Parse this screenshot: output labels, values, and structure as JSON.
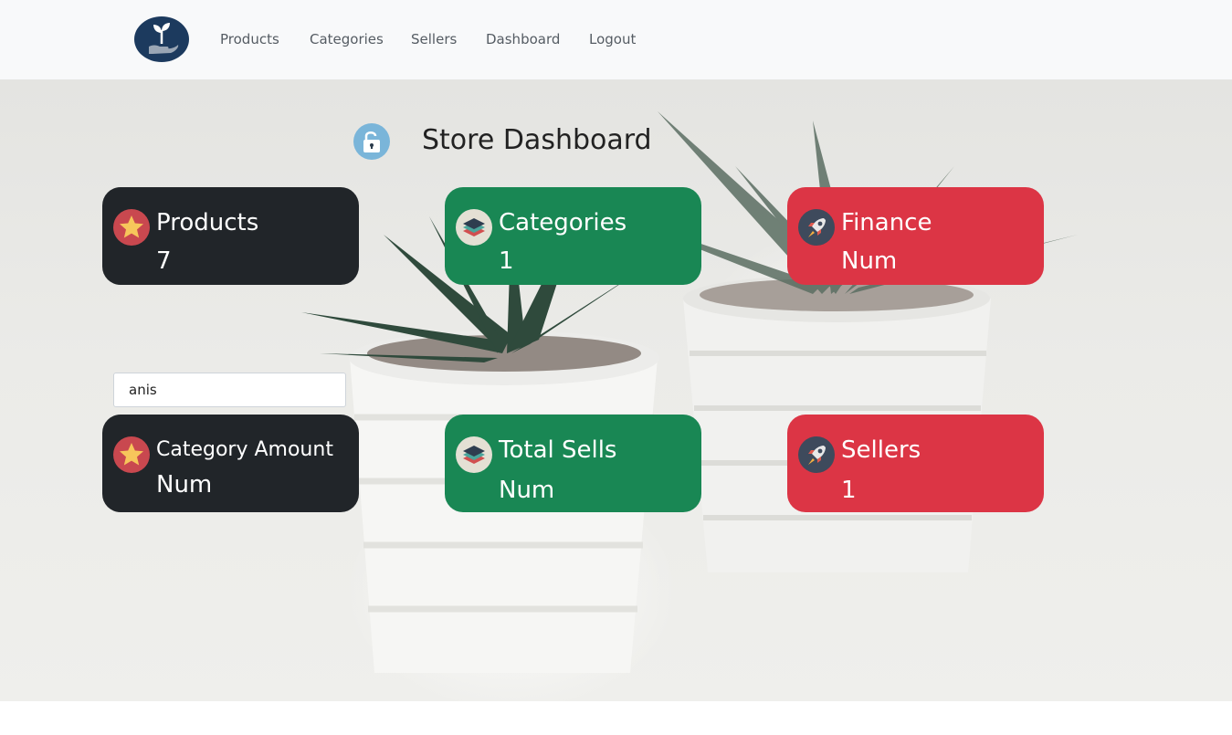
{
  "nav": {
    "items": [
      {
        "label": "Products"
      },
      {
        "label": "Categories"
      },
      {
        "label": "Sellers"
      },
      {
        "label": "Dashboard"
      },
      {
        "label": "Logout"
      }
    ]
  },
  "page": {
    "title": "Store Dashboard",
    "title_icon": "unlock-icon"
  },
  "cards": [
    {
      "label": "Products",
      "value": "7",
      "color": "#212529",
      "icon": "star-icon"
    },
    {
      "label": "Categories",
      "value": "1",
      "color": "#198754",
      "icon": "layers-icon"
    },
    {
      "label": "Finance",
      "value": "Num",
      "color": "#dc3545",
      "icon": "rocket-icon"
    },
    {
      "label": "Category Amount",
      "value": "Num",
      "color": "#212529",
      "icon": "star-icon"
    },
    {
      "label": "Total Sells",
      "value": "Num",
      "color": "#198754",
      "icon": "layers-icon"
    },
    {
      "label": "Sellers",
      "value": "1",
      "color": "#dc3545",
      "icon": "rocket-icon"
    }
  ],
  "search": {
    "value": "anis"
  },
  "colors": {
    "navbar": "#f8f9fa",
    "dark": "#212529",
    "green": "#198754",
    "red": "#dc3545"
  }
}
